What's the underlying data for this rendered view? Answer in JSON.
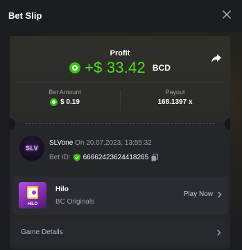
{
  "window": {
    "title": "Bet Slip"
  },
  "profit": {
    "label": "Profit",
    "value": "+$ 33.42",
    "currency": "BCD",
    "color": "#4ede1f"
  },
  "stats": {
    "bet_amount_label": "Bet Amount",
    "bet_amount_value": "$ 0.19",
    "payout_label": "Payout",
    "payout_value": "168.1397 x"
  },
  "user": {
    "avatar_text": "SLV",
    "name": "SLVone",
    "timestamp": "On 20.07.2023, 13:55:32",
    "bet_id_label": "Bet ID:",
    "bet_id": "66662423624418265"
  },
  "game": {
    "name": "Hilo",
    "provider": "BC Originals",
    "thumb_text": "HILO",
    "play_label": "Play Now"
  },
  "details": {
    "label": "Game Details"
  },
  "icons": {
    "close": "close-icon",
    "share": "share-icon",
    "coin": "bcd-coin-icon",
    "shield": "verified-shield-icon",
    "copy": "copy-icon",
    "chevron": "chevron-right-icon"
  }
}
